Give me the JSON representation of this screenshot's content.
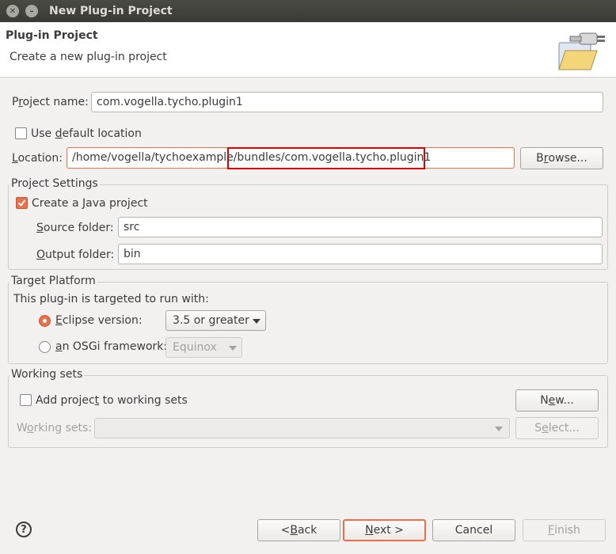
{
  "window": {
    "title": "New Plug-in Project"
  },
  "header": {
    "title": "Plug-in Project",
    "subtitle": "Create a new plug-in project",
    "icon": "plugin-folder-icon"
  },
  "project_name": {
    "label_pre": "P",
    "label_u": "r",
    "label_post": "oject name:",
    "value": "com.vogella.tycho.plugin1"
  },
  "use_default_location": {
    "label_pre": "Use ",
    "label_u": "d",
    "label_post": "efault location",
    "checked": false
  },
  "location": {
    "label_pre": "",
    "label_u": "L",
    "label_post": "ocation:",
    "value": "/home/vogella/tychoexample/bundles/com.vogella.tycho.plugin1",
    "browse_pre": "B",
    "browse_u": "r",
    "browse_post": "owse..."
  },
  "project_settings": {
    "title": "Project Settings",
    "create_java_pre": "Create a ",
    "create_java_u": "J",
    "create_java_post": "ava project",
    "create_java_checked": true,
    "source_label_pre": "",
    "source_label_u": "S",
    "source_label_post": "ource folder:",
    "source_value": "src",
    "output_label_pre": "",
    "output_label_u": "O",
    "output_label_post": "utput folder:",
    "output_value": "bin"
  },
  "target_platform": {
    "title": "Target Platform",
    "description": "This plug-in is targeted to run with:",
    "eclipse_pre": "",
    "eclipse_u": "E",
    "eclipse_post": "clipse version:",
    "eclipse_selected": true,
    "eclipse_value": "3.5 or greater",
    "osgi_pre": "",
    "osgi_u": "a",
    "osgi_post": "n OSGi framework:",
    "osgi_value": "Equinox"
  },
  "working_sets": {
    "title": "Working sets",
    "add_pre": "Add projec",
    "add_u": "t",
    "add_post": " to working sets",
    "add_checked": false,
    "new_pre": "N",
    "new_u": "e",
    "new_post": "w...",
    "sets_label_pre": "W",
    "sets_label_u": "o",
    "sets_label_post": "rking sets:",
    "sets_value": "",
    "select_pre": "S",
    "select_u": "e",
    "select_post": "lect..."
  },
  "footer": {
    "back_pre": "< ",
    "back_u": "B",
    "back_post": "ack",
    "next_pre": "",
    "next_u": "N",
    "next_post": "ext >",
    "cancel": "Cancel",
    "finish_pre": "",
    "finish_u": "F",
    "finish_post": "inish"
  },
  "colors": {
    "accent": "#e9704a",
    "highlight": "#e00000",
    "titlebar": "#3c3b37"
  }
}
